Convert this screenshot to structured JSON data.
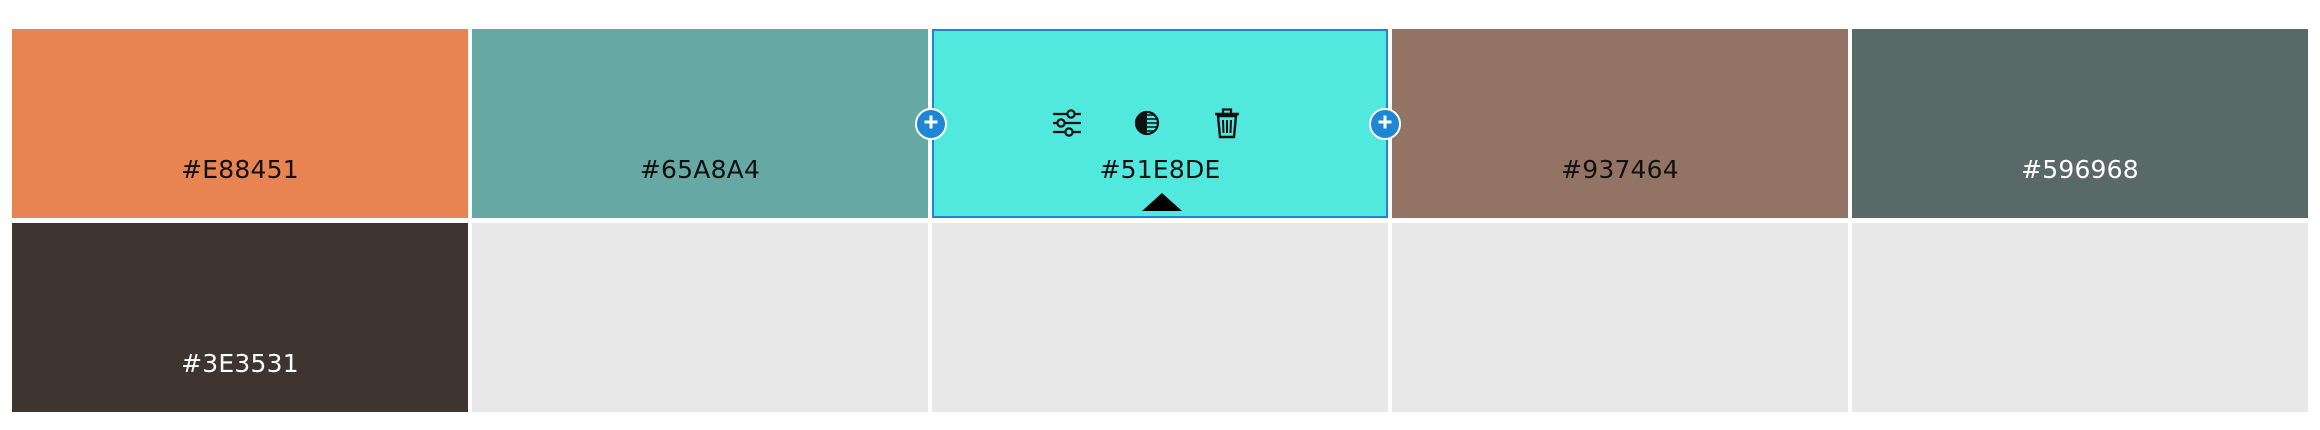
{
  "palette": {
    "colors": [
      {
        "hex": "#E88451",
        "text_tone": "dark"
      },
      {
        "hex": "#65A8A4",
        "text_tone": "dark"
      },
      {
        "hex": "#51E8DE",
        "text_tone": "dark",
        "selected": true
      },
      {
        "hex": "#937464",
        "text_tone": "dark"
      },
      {
        "hex": "#596968",
        "text_tone": "light"
      },
      {
        "hex": "#3E3531",
        "text_tone": "light"
      }
    ],
    "empty_color": "#E8E8E8",
    "selection_border_color": "#1F86D6"
  },
  "icons": {
    "adjust": "sliders-icon",
    "contrast": "contrast-icon",
    "delete": "trash-icon",
    "add": "plus-icon",
    "expand": "caret-up-icon"
  }
}
